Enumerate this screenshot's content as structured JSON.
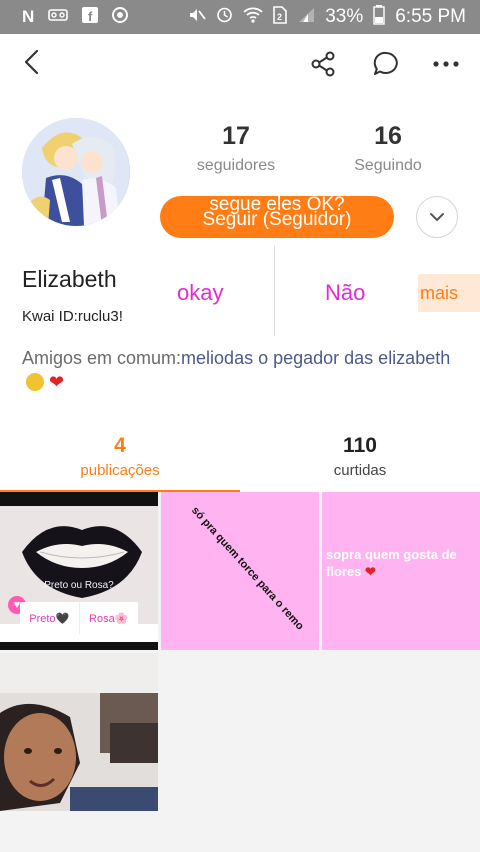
{
  "status_bar": {
    "time": "6:55 PM",
    "battery": "33%",
    "left_icons": [
      "N",
      "voicemail-icon",
      "facebook-icon",
      "chrome-icon"
    ],
    "right_icons": [
      "mute-icon",
      "alarm-icon",
      "wifi-icon",
      "sim-icon",
      "signal-icon",
      "battery-icon"
    ]
  },
  "toolbar": {
    "back_icon": "back-arrow-icon",
    "share_icon": "share-icon",
    "chat_icon": "chat-icon",
    "more_icon": "more-icon"
  },
  "profile": {
    "name": "Elizabeth",
    "kwai_id": "Kwai ID:ruclu3!",
    "followers_count": "17",
    "followers_label": "seguidores",
    "following_count": "16",
    "following_label": "Seguindo",
    "follow_overlay_text": "segue eles OK?",
    "follow_button_label": "Seguir (Seguidor)",
    "poll_option_1": "okay",
    "poll_option_2": "Não",
    "more_label": "mais",
    "mutual_prefix": "Amigos em comum:",
    "mutual_names": "meliodas o pegador das elizabeth"
  },
  "tabs": [
    {
      "count": "4",
      "label": "publicações",
      "active": true
    },
    {
      "count": "110",
      "label": "curtidas",
      "active": false
    }
  ],
  "posts": [
    {
      "question": "Preto ou Rosa?",
      "option_1": "Preto🖤",
      "option_2": "Rosa🌸"
    },
    {
      "caption": "só pra quem torce para o remo"
    },
    {
      "caption": "sopra quem gosta de flores"
    },
    {
      "caption": ""
    }
  ],
  "colors": {
    "accent": "#ff7d14",
    "poll_text": "#e32ad6",
    "pink_post": "#ffb3f0"
  }
}
